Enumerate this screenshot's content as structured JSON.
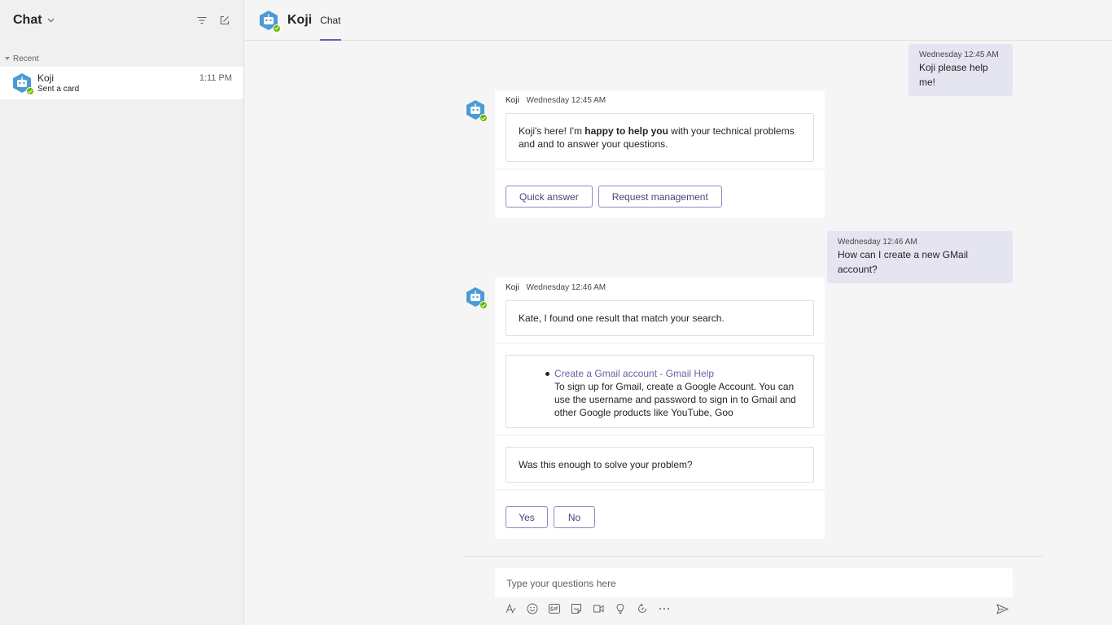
{
  "sidebar": {
    "title": "Chat",
    "section_label": "Recent",
    "chats": [
      {
        "name": "Koji",
        "preview": "Sent a card",
        "time": "1:11 PM"
      }
    ]
  },
  "header": {
    "contact_name": "Koji",
    "tab_label": "Chat"
  },
  "messages": {
    "out1": {
      "meta": "Wednesday 12:45 AM",
      "text": "Koji please help me!"
    },
    "bot1": {
      "sender": "Koji",
      "time": "Wednesday 12:45 AM",
      "text_pre": "Koji's here! I'm ",
      "text_bold": "happy to help you",
      "text_post": " with your technical problems and and to answer your questions.",
      "buttons": [
        "Quick answer",
        "Request management"
      ]
    },
    "out2": {
      "meta": "Wednesday 12:46 AM",
      "text": "How can I create a new GMail account?"
    },
    "bot2": {
      "sender": "Koji",
      "time": "Wednesday 12:46 AM",
      "intro": "Kate, I found one result that match your search.",
      "result_title": "Create a Gmail account - Gmail Help",
      "result_snippet": "To sign up for Gmail, create a Google Account. You can use the username and password to sign in to Gmail and other Google products like YouTube, Goo",
      "question": "Was this enough to solve your problem?",
      "buttons": [
        "Yes",
        "No"
      ]
    }
  },
  "compose": {
    "placeholder": "Type your questions here"
  },
  "colors": {
    "accent": "#6264a7",
    "bot_avatar": "#4a9bd6",
    "presence_available": "#6bb700",
    "outgoing_bubble": "#e5e5f1"
  }
}
